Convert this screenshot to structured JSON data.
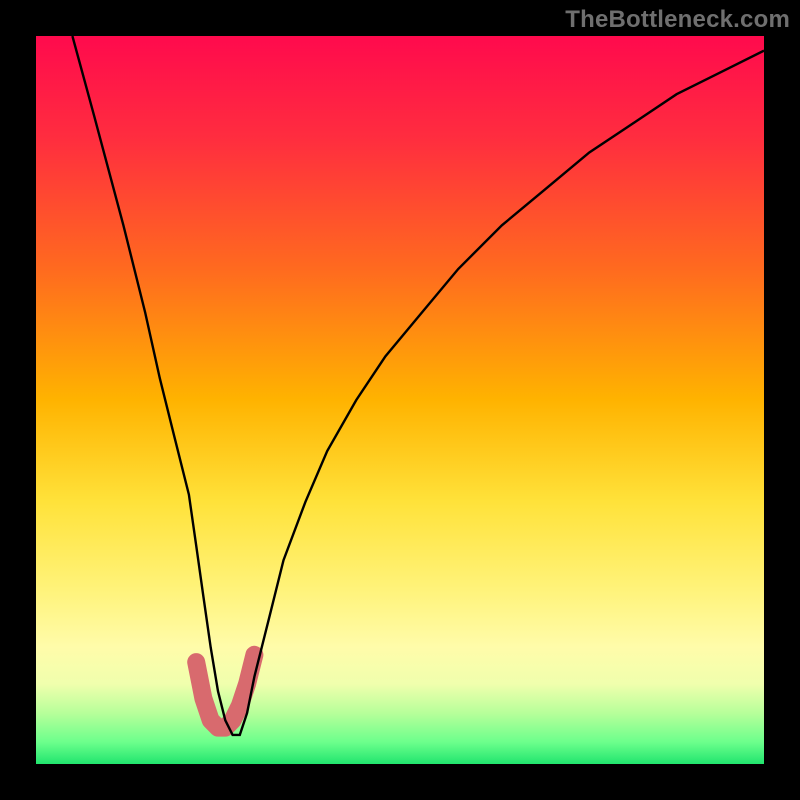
{
  "watermark": "TheBottleneck.com",
  "gradient_stops": [
    {
      "pct": 0,
      "color": "#ff0a4d"
    },
    {
      "pct": 14,
      "color": "#ff2d3f"
    },
    {
      "pct": 32,
      "color": "#ff6a1f"
    },
    {
      "pct": 50,
      "color": "#ffb300"
    },
    {
      "pct": 64,
      "color": "#ffe23a"
    },
    {
      "pct": 76,
      "color": "#fff37a"
    },
    {
      "pct": 84,
      "color": "#fffcaa"
    },
    {
      "pct": 89,
      "color": "#f0ffad"
    },
    {
      "pct": 93,
      "color": "#b7ff9a"
    },
    {
      "pct": 97,
      "color": "#6cff8c"
    },
    {
      "pct": 100,
      "color": "#21e56e"
    }
  ],
  "chart_data": {
    "type": "line",
    "title": "",
    "xlabel": "",
    "ylabel": "",
    "xlim": [
      0,
      100
    ],
    "ylim": [
      0,
      100
    ],
    "series": [
      {
        "name": "bottleneck-curve",
        "x": [
          5,
          8,
          12,
          15,
          17,
          19,
          21,
          22,
          23,
          24,
          25,
          26,
          27,
          28,
          29,
          30,
          32,
          34,
          37,
          40,
          44,
          48,
          53,
          58,
          64,
          70,
          76,
          82,
          88,
          94,
          100
        ],
        "values": [
          100,
          89,
          74,
          62,
          53,
          45,
          37,
          30,
          23,
          16,
          10,
          6,
          4,
          4,
          7,
          12,
          20,
          28,
          36,
          43,
          50,
          56,
          62,
          68,
          74,
          79,
          84,
          88,
          92,
          95,
          98
        ],
        "stroke": "#000",
        "width": 2.4
      },
      {
        "name": "pink-trough",
        "x": [
          22,
          23,
          24,
          25,
          26,
          27,
          28,
          29,
          30
        ],
        "values": [
          14,
          9,
          6,
          5,
          5,
          6,
          8,
          11,
          15
        ],
        "stroke": "#d86a6e",
        "width": 18,
        "linecap": "round"
      }
    ]
  }
}
